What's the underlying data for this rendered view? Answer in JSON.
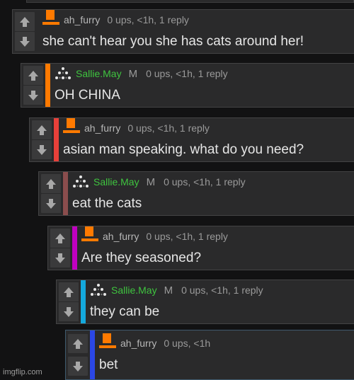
{
  "colors": {
    "orange": "#ff7a00",
    "green_user": "#3fc43f",
    "bar_red": "#e8403a",
    "bar_brown": "#8a4d4d",
    "bar_magenta": "#c000c0",
    "bar_cyan": "#14a9dd",
    "bar_blue": "#2b47e6",
    "bar_orange": "#ff7a00"
  },
  "icons": {
    "upvote": "up-arrow-icon",
    "downvote": "down-arrow-icon",
    "avatar_orange": "orange-hat-avatar-icon",
    "avatar_stars": "dot-pyramid-avatar-icon"
  },
  "comments": [
    {
      "username": "ah_furry",
      "mod": "",
      "stats": "0 ups, <1h, 1 reply",
      "text": "she can't hear you she has cats around her!"
    },
    {
      "username": "Sallie.May",
      "mod": "M",
      "stats": "0 ups, <1h, 1 reply",
      "text": "OH CHINA"
    },
    {
      "username": "ah_furry",
      "mod": "",
      "stats": "0 ups, <1h, 1 reply",
      "text": "asian man speaking. what do you need?"
    },
    {
      "username": "Sallie.May",
      "mod": "M",
      "stats": "0 ups, <1h, 1 reply",
      "text": "eat the cats"
    },
    {
      "username": "ah_furry",
      "mod": "",
      "stats": "0 ups, <1h, 1 reply",
      "text": "Are they seasoned?"
    },
    {
      "username": "Sallie.May",
      "mod": "M",
      "stats": "0 ups, <1h, 1 reply",
      "text": "they can be"
    },
    {
      "username": "ah_furry",
      "mod": "",
      "stats": "0 ups, <1h",
      "text": "bet"
    }
  ],
  "watermark": "imgflip.com"
}
